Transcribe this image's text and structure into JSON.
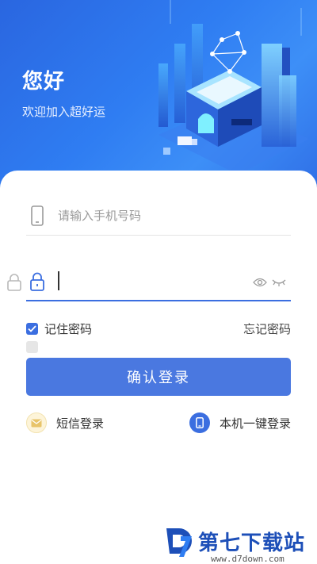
{
  "header": {
    "title": "您好",
    "subtitle": "欢迎加入超好运"
  },
  "form": {
    "phone_placeholder": "请输入手机号码",
    "password_value": "",
    "remember_label": "记住密码",
    "remember_checked": true,
    "forgot_label": "忘记密码",
    "login_label": "确认登录"
  },
  "alt_login": {
    "sms_label": "短信登录",
    "onekey_label": "本机一键登录"
  },
  "watermark": {
    "brand": "第七下载站",
    "url": "www.d7down.com"
  },
  "colors": {
    "accent": "#3b6ee0",
    "button": "#4a78e0",
    "hero_start": "#2a66e0",
    "hero_end": "#3d8ff7"
  }
}
